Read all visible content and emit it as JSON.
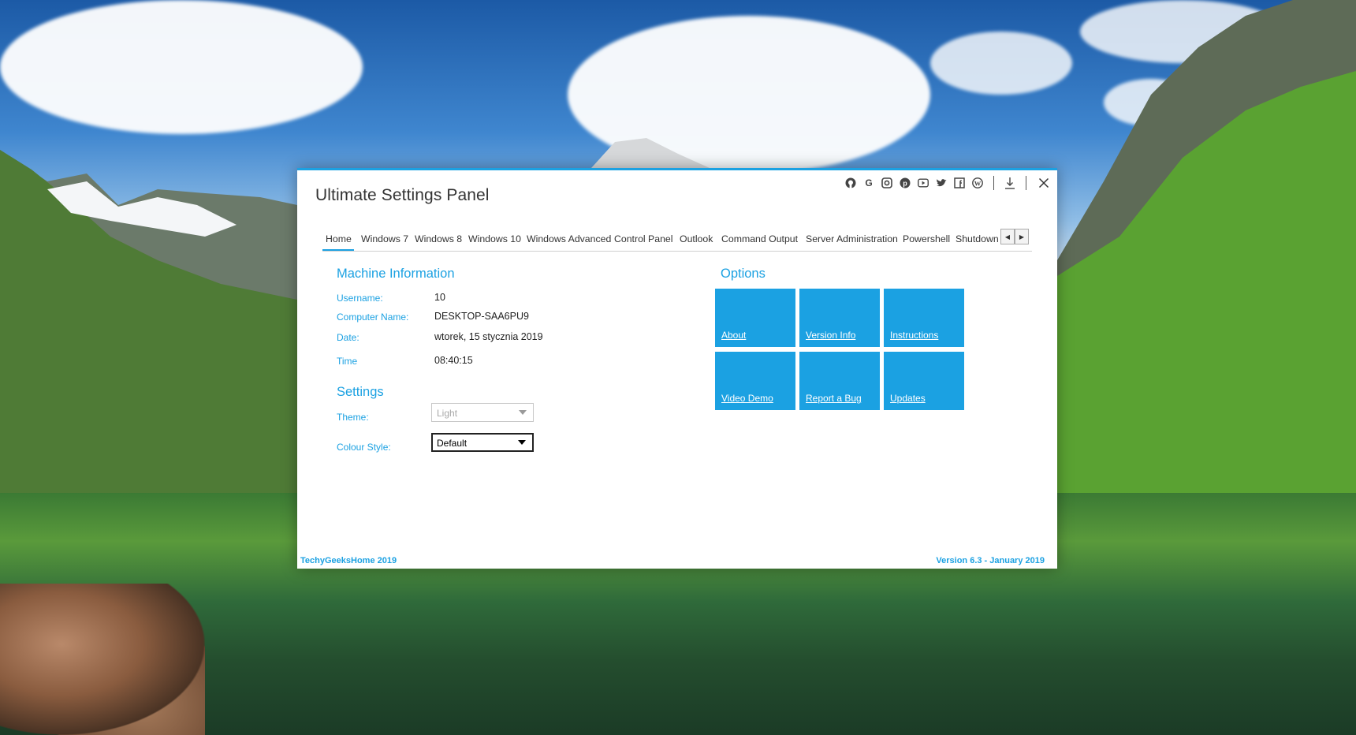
{
  "colors": {
    "accent": "#1ba1e2",
    "text": "#333333"
  },
  "window": {
    "title": "Ultimate Settings Panel",
    "title_icons": [
      "github-icon",
      "google-icon",
      "instagram-icon",
      "pinterest-icon",
      "youtube-icon",
      "twitter-icon",
      "facebook-icon",
      "wordpress-icon",
      "download-icon",
      "close-icon"
    ]
  },
  "tabs": [
    {
      "label": "Home",
      "active": true
    },
    {
      "label": "Windows 7"
    },
    {
      "label": "Windows 8"
    },
    {
      "label": "Windows 10"
    },
    {
      "label": "Windows Advanced"
    },
    {
      "label": "Control Panel"
    },
    {
      "label": "Outlook"
    },
    {
      "label": "Command Output"
    },
    {
      "label": "Server Administration"
    },
    {
      "label": "Powershell"
    },
    {
      "label": "Shutdown C"
    }
  ],
  "machine_info": {
    "title": "Machine Information",
    "username_label": "Username:",
    "username": "10",
    "computer_name_label": "Computer Name:",
    "computer_name": "DESKTOP-SAA6PU9",
    "date_label": "Date:",
    "date": "wtorek, 15 stycznia 2019",
    "time_label": "Time",
    "time": "08:40:15"
  },
  "settings": {
    "title": "Settings",
    "theme_label": "Theme:",
    "theme_value": "Light",
    "colour_style_label": "Colour Style:",
    "colour_style_value": "Default"
  },
  "options": {
    "title": "Options",
    "tiles": [
      "About",
      "Version Info",
      "Instructions",
      "Video Demo",
      "Report a Bug",
      "Updates"
    ]
  },
  "footer": {
    "left": "TechyGeeksHome 2019",
    "right": "Version 6.3 - January 2019"
  }
}
